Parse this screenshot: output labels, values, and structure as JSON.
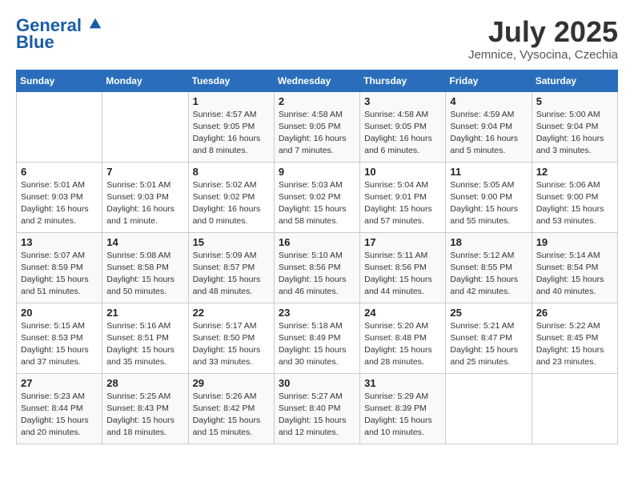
{
  "header": {
    "logo_line1": "General",
    "logo_line2": "Blue",
    "month_title": "July 2025",
    "location": "Jemnice, Vysocina, Czechia"
  },
  "weekdays": [
    "Sunday",
    "Monday",
    "Tuesday",
    "Wednesday",
    "Thursday",
    "Friday",
    "Saturday"
  ],
  "weeks": [
    [
      {
        "day": "",
        "detail": ""
      },
      {
        "day": "",
        "detail": ""
      },
      {
        "day": "1",
        "detail": "Sunrise: 4:57 AM\nSunset: 9:05 PM\nDaylight: 16 hours\nand 8 minutes."
      },
      {
        "day": "2",
        "detail": "Sunrise: 4:58 AM\nSunset: 9:05 PM\nDaylight: 16 hours\nand 7 minutes."
      },
      {
        "day": "3",
        "detail": "Sunrise: 4:58 AM\nSunset: 9:05 PM\nDaylight: 16 hours\nand 6 minutes."
      },
      {
        "day": "4",
        "detail": "Sunrise: 4:59 AM\nSunset: 9:04 PM\nDaylight: 16 hours\nand 5 minutes."
      },
      {
        "day": "5",
        "detail": "Sunrise: 5:00 AM\nSunset: 9:04 PM\nDaylight: 16 hours\nand 3 minutes."
      }
    ],
    [
      {
        "day": "6",
        "detail": "Sunrise: 5:01 AM\nSunset: 9:03 PM\nDaylight: 16 hours\nand 2 minutes."
      },
      {
        "day": "7",
        "detail": "Sunrise: 5:01 AM\nSunset: 9:03 PM\nDaylight: 16 hours\nand 1 minute."
      },
      {
        "day": "8",
        "detail": "Sunrise: 5:02 AM\nSunset: 9:02 PM\nDaylight: 16 hours\nand 0 minutes."
      },
      {
        "day": "9",
        "detail": "Sunrise: 5:03 AM\nSunset: 9:02 PM\nDaylight: 15 hours\nand 58 minutes."
      },
      {
        "day": "10",
        "detail": "Sunrise: 5:04 AM\nSunset: 9:01 PM\nDaylight: 15 hours\nand 57 minutes."
      },
      {
        "day": "11",
        "detail": "Sunrise: 5:05 AM\nSunset: 9:00 PM\nDaylight: 15 hours\nand 55 minutes."
      },
      {
        "day": "12",
        "detail": "Sunrise: 5:06 AM\nSunset: 9:00 PM\nDaylight: 15 hours\nand 53 minutes."
      }
    ],
    [
      {
        "day": "13",
        "detail": "Sunrise: 5:07 AM\nSunset: 8:59 PM\nDaylight: 15 hours\nand 51 minutes."
      },
      {
        "day": "14",
        "detail": "Sunrise: 5:08 AM\nSunset: 8:58 PM\nDaylight: 15 hours\nand 50 minutes."
      },
      {
        "day": "15",
        "detail": "Sunrise: 5:09 AM\nSunset: 8:57 PM\nDaylight: 15 hours\nand 48 minutes."
      },
      {
        "day": "16",
        "detail": "Sunrise: 5:10 AM\nSunset: 8:56 PM\nDaylight: 15 hours\nand 46 minutes."
      },
      {
        "day": "17",
        "detail": "Sunrise: 5:11 AM\nSunset: 8:56 PM\nDaylight: 15 hours\nand 44 minutes."
      },
      {
        "day": "18",
        "detail": "Sunrise: 5:12 AM\nSunset: 8:55 PM\nDaylight: 15 hours\nand 42 minutes."
      },
      {
        "day": "19",
        "detail": "Sunrise: 5:14 AM\nSunset: 8:54 PM\nDaylight: 15 hours\nand 40 minutes."
      }
    ],
    [
      {
        "day": "20",
        "detail": "Sunrise: 5:15 AM\nSunset: 8:53 PM\nDaylight: 15 hours\nand 37 minutes."
      },
      {
        "day": "21",
        "detail": "Sunrise: 5:16 AM\nSunset: 8:51 PM\nDaylight: 15 hours\nand 35 minutes."
      },
      {
        "day": "22",
        "detail": "Sunrise: 5:17 AM\nSunset: 8:50 PM\nDaylight: 15 hours\nand 33 minutes."
      },
      {
        "day": "23",
        "detail": "Sunrise: 5:18 AM\nSunset: 8:49 PM\nDaylight: 15 hours\nand 30 minutes."
      },
      {
        "day": "24",
        "detail": "Sunrise: 5:20 AM\nSunset: 8:48 PM\nDaylight: 15 hours\nand 28 minutes."
      },
      {
        "day": "25",
        "detail": "Sunrise: 5:21 AM\nSunset: 8:47 PM\nDaylight: 15 hours\nand 25 minutes."
      },
      {
        "day": "26",
        "detail": "Sunrise: 5:22 AM\nSunset: 8:45 PM\nDaylight: 15 hours\nand 23 minutes."
      }
    ],
    [
      {
        "day": "27",
        "detail": "Sunrise: 5:23 AM\nSunset: 8:44 PM\nDaylight: 15 hours\nand 20 minutes."
      },
      {
        "day": "28",
        "detail": "Sunrise: 5:25 AM\nSunset: 8:43 PM\nDaylight: 15 hours\nand 18 minutes."
      },
      {
        "day": "29",
        "detail": "Sunrise: 5:26 AM\nSunset: 8:42 PM\nDaylight: 15 hours\nand 15 minutes."
      },
      {
        "day": "30",
        "detail": "Sunrise: 5:27 AM\nSunset: 8:40 PM\nDaylight: 15 hours\nand 12 minutes."
      },
      {
        "day": "31",
        "detail": "Sunrise: 5:29 AM\nSunset: 8:39 PM\nDaylight: 15 hours\nand 10 minutes."
      },
      {
        "day": "",
        "detail": ""
      },
      {
        "day": "",
        "detail": ""
      }
    ]
  ]
}
